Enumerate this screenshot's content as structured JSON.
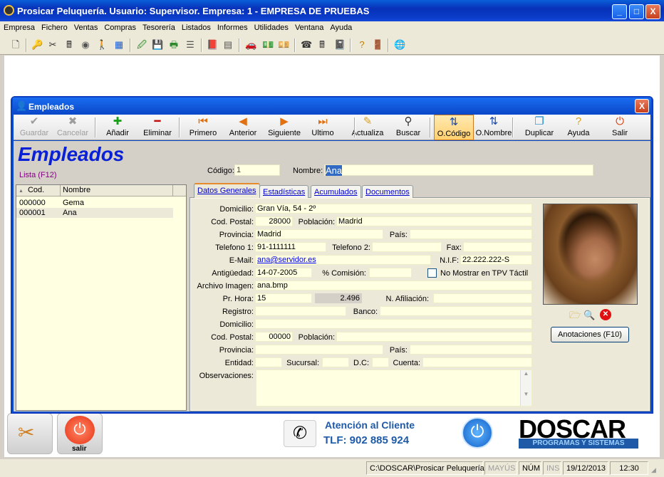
{
  "main_window": {
    "title": "Prosicar Peluquería. Usuario: Supervisor. Empresa: 1 - EMPRESA DE PRUEBAS",
    "buttons": {
      "minimize": "_",
      "maximize": "□",
      "close": "X"
    }
  },
  "menu": [
    "Empresa",
    "Fichero",
    "Ventas",
    "Compras",
    "Tesorería",
    "Listados",
    "Informes",
    "Utilidades",
    "Ventana",
    "Ayuda"
  ],
  "main_toolbar_icons": [
    "new-document-icon",
    "key-icon",
    "scissors-icon",
    "cash-register-icon",
    "pizza-icon",
    "person-icon",
    "color-grid-icon",
    "edit-document-icon",
    "save-green-icon",
    "printer-green-icon",
    "list-icon",
    "red-book-icon",
    "grid-sheet-icon",
    "car-icon",
    "money-green-icon",
    "money-red-icon",
    "phone-icon",
    "calculator-icon",
    "notebook-icon",
    "help-icon",
    "exit-door-icon",
    "globe-icon"
  ],
  "employees_window": {
    "title": "Empleados",
    "close": "X",
    "heading": "Empleados",
    "list_link": "Lista (F12)",
    "toolbar": [
      {
        "name": "guardar",
        "label": "Guardar",
        "icon": "✔",
        "enabled": false
      },
      {
        "name": "cancelar",
        "label": "Cancelar",
        "icon": "✖",
        "enabled": false
      },
      {
        "name": "anadir",
        "label": "Añadir",
        "icon": "✚",
        "enabled": true
      },
      {
        "name": "eliminar",
        "label": "Eliminar",
        "icon": "━",
        "enabled": true
      },
      {
        "name": "primero",
        "label": "Primero",
        "icon": "⏮",
        "enabled": true
      },
      {
        "name": "anterior",
        "label": "Anterior",
        "icon": "◀",
        "enabled": true
      },
      {
        "name": "siguiente",
        "label": "Siguiente",
        "icon": "▶",
        "enabled": true
      },
      {
        "name": "ultimo",
        "label": "Ultimo",
        "icon": "⏭",
        "enabled": true
      },
      {
        "name": "actualiza",
        "label": "Actualiza",
        "icon": "✎",
        "enabled": true
      },
      {
        "name": "buscar",
        "label": "Buscar",
        "icon": "⚲",
        "enabled": true
      },
      {
        "name": "o-codigo",
        "label": "O.Código",
        "icon": "⇅",
        "enabled": true,
        "active": true
      },
      {
        "name": "o-nombre",
        "label": "O.Nombre",
        "icon": "⇅",
        "enabled": true
      },
      {
        "name": "duplicar",
        "label": "Duplicar",
        "icon": "❐",
        "enabled": true
      },
      {
        "name": "ayuda",
        "label": "Ayuda",
        "icon": "?",
        "enabled": true
      },
      {
        "name": "salir",
        "label": "Salir",
        "icon": "⏻",
        "enabled": true
      }
    ],
    "codigo_label": "Código:",
    "codigo_value": "1",
    "nombre_label": "Nombre:",
    "nombre_value": "Ana",
    "list": {
      "columns": [
        "Cod.",
        "Nombre"
      ],
      "rows": [
        {
          "cod": "000000",
          "nombre": "Gema"
        },
        {
          "cod": "000001",
          "nombre": "Ana"
        }
      ]
    },
    "tabs": [
      "Datos Generales",
      "Estadísticas",
      "Acumulados",
      "Documentos"
    ],
    "form": {
      "domicilio_label": "Domicilio:",
      "domicilio": "Gran Vía, 54 - 2º",
      "cp_label": "Cod. Postal:",
      "cp": "28000",
      "poblacion_label": "Población:",
      "poblacion": "Madrid",
      "provincia_label": "Provincia:",
      "provincia": "Madrid",
      "pais_label": "País:",
      "pais": "",
      "tel1_label": "Telefono 1:",
      "tel1": "91-1111111",
      "tel2_label": "Telefono 2:",
      "tel2": "",
      "fax_label": "Fax:",
      "fax": "",
      "email_label": "E-Mail:",
      "email": "ana@servidor.es",
      "nif_label": "N.I.F:",
      "nif": "22.222.222-S",
      "antiguedad_label": "Antigüedad:",
      "antiguedad": "14-07-2005",
      "comision_label": "% Comisión:",
      "comision": "",
      "no_tpv_label": "No Mostrar en TPV Táctil",
      "archivo_label": "Archivo Imagen:",
      "archivo": "ana.bmp",
      "prhora_label": "Pr. Hora:",
      "prhora": "15",
      "prhora_calc": "2.496",
      "afiliacion_label": "N. Afiliación:",
      "afiliacion": "",
      "registro_label": "Registro:",
      "registro": "",
      "banco_label": "Banco:",
      "banco": "",
      "domicilio2_label": "Domicilio:",
      "domicilio2": "",
      "cp2_label": "Cod. Postal:",
      "cp2": "00000",
      "poblacion2_label": "Población:",
      "poblacion2": "",
      "provincia2_label": "Provincia:",
      "provincia2": "",
      "pais2_label": "País:",
      "pais2": "",
      "entidad_label": "Entidad:",
      "entidad": "",
      "sucursal_label": "Sucursal:",
      "sucursal": "",
      "dc_label": "D.C:",
      "dc": "",
      "cuenta_label": "Cuenta:",
      "cuenta": "",
      "observaciones_label": "Observaciones:"
    },
    "anotaciones_button": "Anotaciones (F10)"
  },
  "bottom": {
    "salir_label": "salir",
    "atencion_title": "Atención al Cliente",
    "atencion_phone": "TLF: 902 885 924",
    "brand": "DOSCAR",
    "brand_sub": "PROGRAMAS Y SISTEMAS"
  },
  "statusbar": {
    "path": "C:\\DOSCAR\\Prosicar Peluquería",
    "mayus": "MAYÚS",
    "num": "NÚM",
    "ins": "INS",
    "date": "19/12/2013",
    "time": "12:30"
  }
}
